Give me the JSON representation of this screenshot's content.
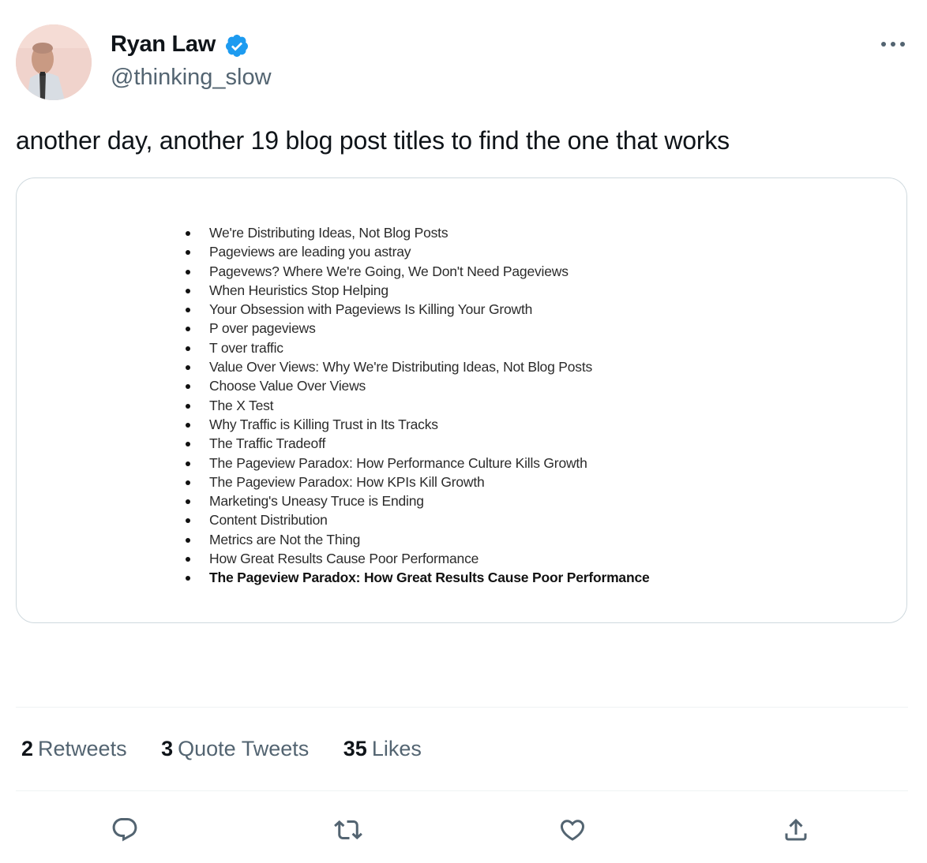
{
  "author": {
    "name": "Ryan Law",
    "handle": "@thinking_slow",
    "verified_color": "#1d9bf0"
  },
  "tweet": {
    "text": "another day, another 19 blog post titles to find the one that works"
  },
  "image_list": {
    "items": [
      "We're Distributing Ideas, Not Blog Posts",
      "Pageviews are leading you astray",
      "Pagevews? Where We're Going, We Don't Need Pageviews",
      "When Heuristics Stop Helping",
      "Your Obsession with Pageviews Is Killing Your Growth",
      "P over pageviews",
      "T over traffic",
      "Value Over Views: Why We're Distributing Ideas, Not Blog Posts",
      "Choose Value Over Views",
      "The X Test",
      "Why Traffic is Killing Trust in Its Tracks",
      "The Traffic Tradeoff",
      "The Pageview Paradox: How Performance Culture Kills Growth",
      "The Pageview Paradox: How KPIs Kill Growth",
      "Marketing's Uneasy Truce is Ending",
      "Content Distribution",
      "Metrics are Not the Thing",
      "How Great Results Cause Poor Performance",
      "The Pageview Paradox: How Great Results Cause Poor Performance"
    ]
  },
  "stats": {
    "retweets_count": "2",
    "retweets_label": "Retweets",
    "quotes_count": "3",
    "quotes_label": "Quote Tweets",
    "likes_count": "35",
    "likes_label": "Likes"
  },
  "actions": {
    "icons": [
      "reply-icon",
      "retweet-icon",
      "like-icon",
      "share-icon"
    ],
    "color": "#536471"
  }
}
